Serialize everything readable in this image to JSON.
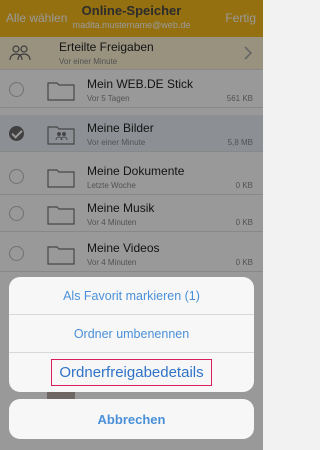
{
  "header": {
    "left_button": "Alle wählen",
    "title": "Online-Speicher",
    "subtitle": "madita.mustername@web.de",
    "right_button": "Fertig"
  },
  "shared": {
    "label": "Erteilte Freigaben",
    "sub": "Vor einer Minute"
  },
  "folders": [
    {
      "name": "Mein WEB.DE Stick",
      "meta": "Vor 5 Tagen",
      "size": "561 KB",
      "selected": false
    },
    {
      "name": "Meine Bilder",
      "meta": "Vor einer Minute",
      "size": "5,8 MB",
      "selected": true
    },
    {
      "name": "Meine Dokumente",
      "meta": "Letzte Woche",
      "size": "0 KB",
      "selected": false
    },
    {
      "name": "Meine Musik",
      "meta": "Vor 4 Minuten",
      "size": "0 KB",
      "selected": false
    },
    {
      "name": "Meine Videos",
      "meta": "Vor 4 Minuten",
      "size": "0 KB",
      "selected": false
    }
  ],
  "action_sheet": {
    "favorite": "Als Favorit markieren (1)",
    "rename": "Ordner umbenennen",
    "share_details": "Ordnerfreigabedetails",
    "cancel": "Abbrechen"
  },
  "colors": {
    "header": "#f8bb1b",
    "action_text": "#4a90d9",
    "highlight_border": "#d81e5b"
  }
}
